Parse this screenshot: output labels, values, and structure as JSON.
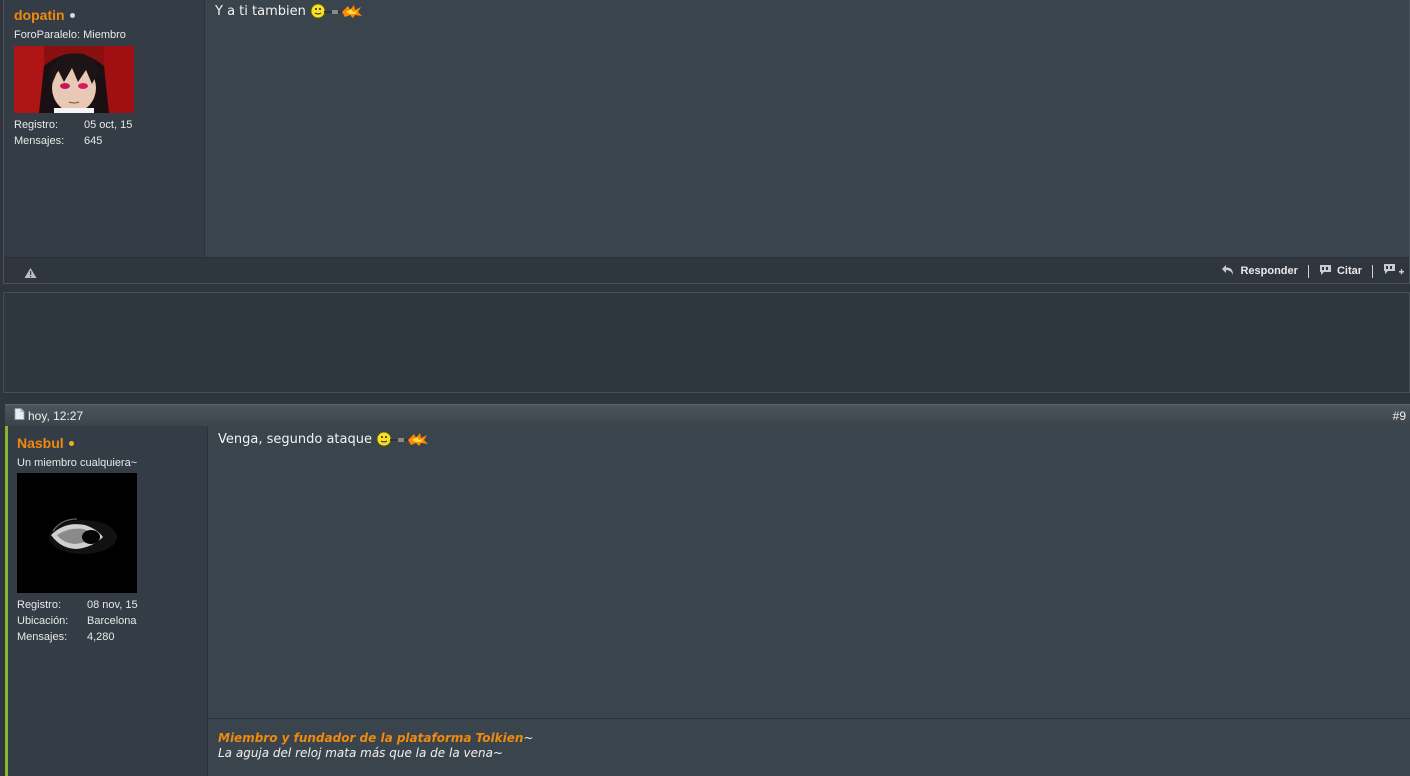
{
  "post1": {
    "username": "dopatin",
    "user_title": "ForoParalelo: Miembro",
    "stats": [
      {
        "label": "Registro:",
        "value": "05 oct, 15"
      },
      {
        "label": "Mensajes:",
        "value": "645"
      }
    ],
    "text": "Y a ti tambien",
    "actions": {
      "reply": "Responder",
      "quote": "Citar"
    }
  },
  "post2": {
    "date": "hoy, 12:27",
    "number": "#9",
    "username": "Nasbul",
    "user_title": "Un miembro cualquiera~",
    "stats": [
      {
        "label": "Registro:",
        "value": "08 nov, 15"
      },
      {
        "label": "Ubicación:",
        "value": "Barcelona"
      },
      {
        "label": "Mensajes:",
        "value": "4,280"
      }
    ],
    "text": "Venga, segundo ataque",
    "signature": {
      "line1": "Miembro y fundador de la plataforma Tolkien",
      "line1_suffix": "~",
      "line2": "La aguja del reloj mata más que la de la vena~"
    }
  },
  "colors": {
    "username": "#f0890f",
    "post_bg": "#3a444c",
    "sidebar_bg": "#343d45",
    "online_accent": "#84b82d"
  },
  "icons": [
    "warning-icon",
    "reply-icon",
    "quote-icon",
    "multiquote-icon",
    "document-icon",
    "smiley-fire-icon"
  ]
}
